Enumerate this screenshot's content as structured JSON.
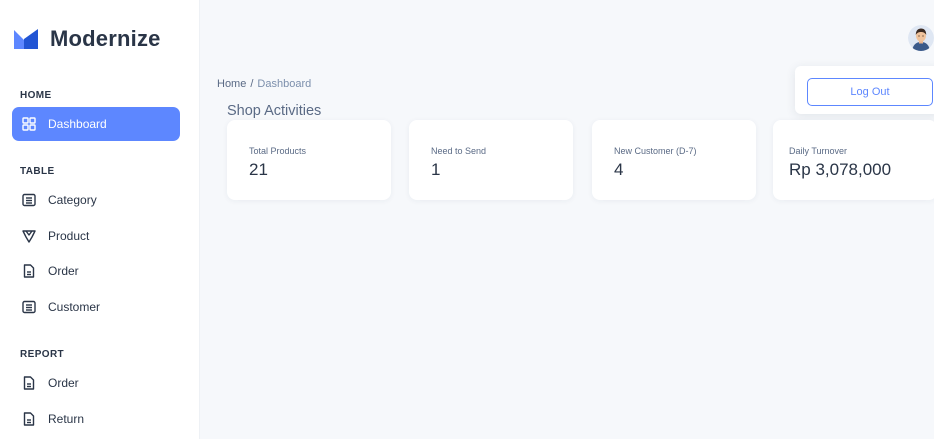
{
  "app": {
    "name": "Modernize"
  },
  "sidebar": {
    "sections": [
      {
        "title": "HOME",
        "items": [
          {
            "label": "Dashboard",
            "icon": "grid-icon",
            "active": true
          }
        ]
      },
      {
        "title": "TABLE",
        "items": [
          {
            "label": "Category",
            "icon": "list-icon"
          },
          {
            "label": "Product",
            "icon": "tag-icon"
          },
          {
            "label": "Order",
            "icon": "file-icon"
          },
          {
            "label": "Customer",
            "icon": "list-icon"
          }
        ]
      },
      {
        "title": "REPORT",
        "items": [
          {
            "label": "Order",
            "icon": "file-icon"
          },
          {
            "label": "Return",
            "icon": "file-icon"
          }
        ]
      }
    ]
  },
  "header": {
    "breadcrumb": {
      "home": "Home",
      "separator": "/",
      "current": "Dashboard"
    },
    "title": "Shop Activities",
    "logout_label": "Log Out"
  },
  "cards": [
    {
      "label": "Total Products",
      "value": "21"
    },
    {
      "label": "Need to Send",
      "value": "1"
    },
    {
      "label": "New Customer (D-7)",
      "value": "4"
    },
    {
      "label": "Daily Turnover",
      "value": "Rp 3,078,000"
    }
  ],
  "colors": {
    "accent": "#5d87ff",
    "text": "#2a3547",
    "muted": "#5a6a85",
    "background": "#f6f8fb"
  }
}
